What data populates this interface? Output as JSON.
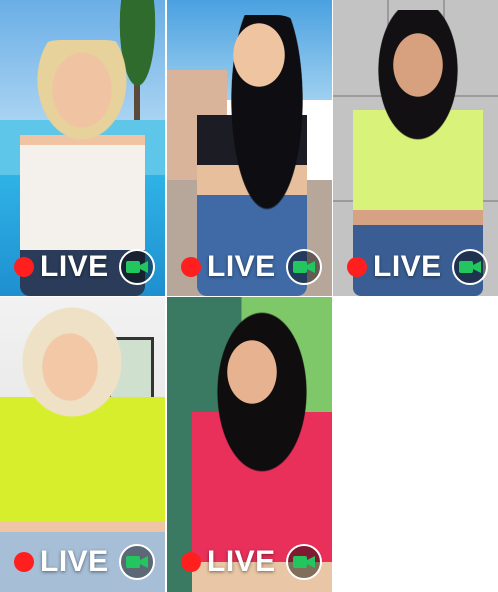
{
  "colors": {
    "live_dot": "#ff1f1f",
    "live_text": "#ffffff",
    "camera_icon": "#22c55e"
  },
  "tiles": [
    {
      "live_label": "LIVE",
      "icon": "video-camera-icon"
    },
    {
      "live_label": "LIVE",
      "icon": "video-camera-icon"
    },
    {
      "live_label": "LIVE",
      "icon": "video-camera-icon"
    },
    {
      "live_label": "LIVE",
      "icon": "video-camera-icon"
    },
    {
      "live_label": "LIVE",
      "icon": "video-camera-icon"
    }
  ]
}
